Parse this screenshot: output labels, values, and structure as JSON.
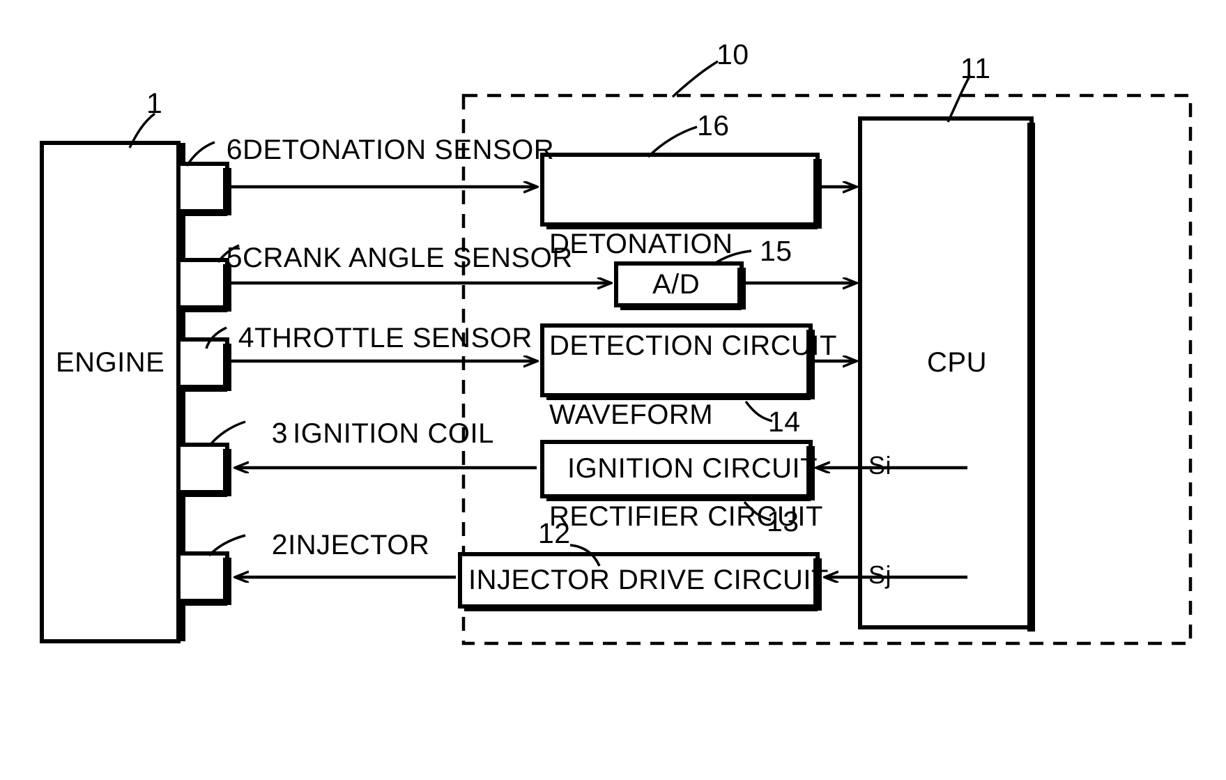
{
  "figure": {
    "type": "engine-control-block-diagram",
    "background_color": "#ffffff",
    "line_color": "#000000"
  },
  "engine": {
    "label": "ENGINE",
    "ref": "1"
  },
  "ecu": {
    "ref": "10",
    "boundary": "dashed"
  },
  "cpu": {
    "label": "CPU",
    "ref": "11"
  },
  "sensors": [
    {
      "ref": "6",
      "name": "DETONATION SENSOR"
    },
    {
      "ref": "5",
      "name": "CRANK ANGLE SENSOR"
    },
    {
      "ref": "4",
      "name": "THROTTLE SENSOR"
    },
    {
      "ref": "3",
      "name": "IGNITION COIL"
    },
    {
      "ref": "2",
      "name": "INJECTOR"
    }
  ],
  "circuits": [
    {
      "ref": "16",
      "line1": "DETONATION",
      "line2": "DETECTION CIRCUIT"
    },
    {
      "ref": "15",
      "line1": "A/D",
      "line2": ""
    },
    {
      "ref": "14",
      "line1": "WAVEFORM",
      "line2": "RECTIFIER CIRCUIT"
    },
    {
      "ref": "13",
      "line1": "IGNITION CIRCUIT",
      "line2": ""
    },
    {
      "ref": "12",
      "line1": "INJECTOR DRIVE CIRCUIT",
      "line2": ""
    }
  ],
  "signals": [
    {
      "name": "Si"
    },
    {
      "name": "Sj"
    }
  ]
}
